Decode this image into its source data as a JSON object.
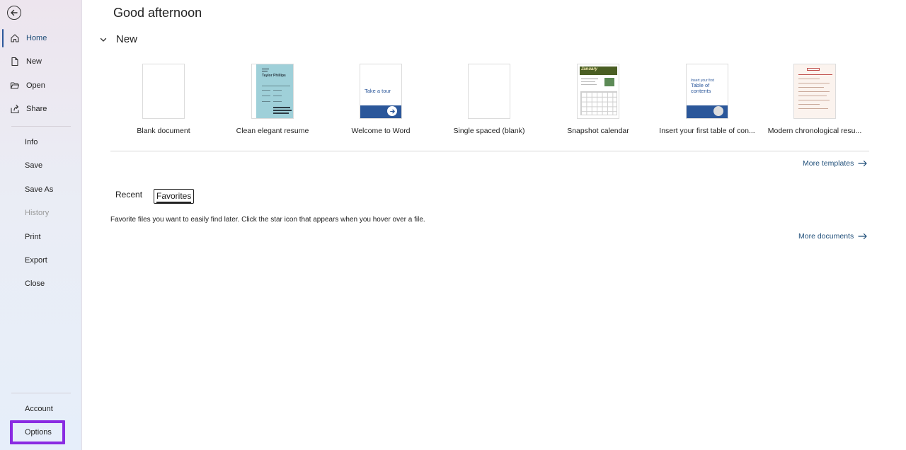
{
  "sidebar": {
    "items": [
      {
        "label": "Home",
        "icon": "home-icon"
      },
      {
        "label": "New",
        "icon": "new-document-icon"
      },
      {
        "label": "Open",
        "icon": "folder-open-icon"
      },
      {
        "label": "Share",
        "icon": "share-icon"
      },
      {
        "label": "Info"
      },
      {
        "label": "Save"
      },
      {
        "label": "Save As"
      },
      {
        "label": "History"
      },
      {
        "label": "Print"
      },
      {
        "label": "Export"
      },
      {
        "label": "Close"
      },
      {
        "label": "Account"
      },
      {
        "label": "Options"
      }
    ],
    "active_item": "Home",
    "disabled_item": "History",
    "highlight_color": "#8a2be2"
  },
  "main": {
    "greeting": "Good afternoon",
    "new_section": {
      "title": "New",
      "templates": [
        {
          "label": "Blank document"
        },
        {
          "label": "Clean elegant resume",
          "thumb_name": "Taylor Phillips"
        },
        {
          "label": "Welcome to Word",
          "thumb_text": "Take a tour"
        },
        {
          "label": "Single spaced (blank)"
        },
        {
          "label": "Snapshot calendar",
          "thumb_text": "January"
        },
        {
          "label": "Insert your first table of con...",
          "thumb_line1": "Insert your first",
          "thumb_line2": "Table of contents"
        },
        {
          "label": "Modern chronological resu..."
        }
      ],
      "more_templates": "More templates"
    },
    "tabs": {
      "recent": "Recent",
      "favorites": "Favorites",
      "selected": "Favorites"
    },
    "favorites_description": "Favorite files you want to easily find later. Click the star icon that appears when you hover over a file.",
    "more_documents": "More documents"
  },
  "colors": {
    "accent": "#2b579a",
    "link": "#1f4e79"
  }
}
